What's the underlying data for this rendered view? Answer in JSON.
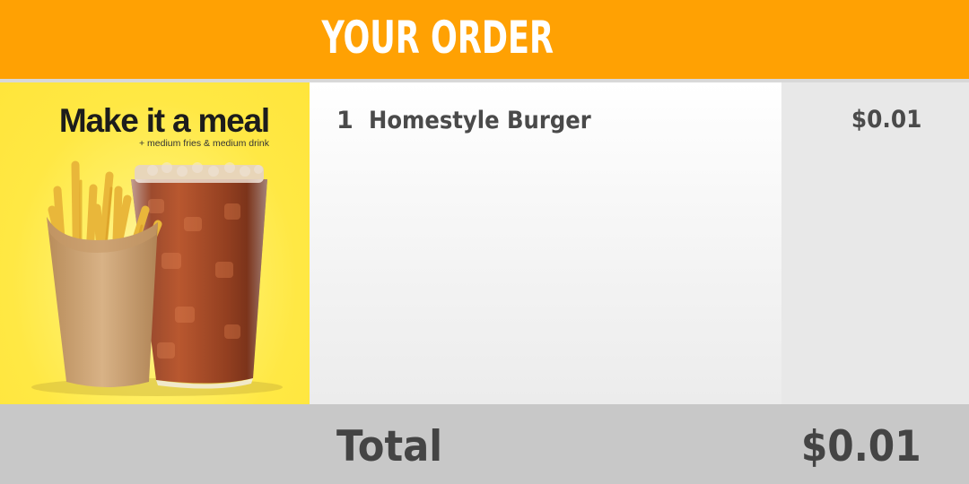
{
  "header": {
    "title": "YOUR ORDER",
    "background_color": "#ffa103"
  },
  "promo": {
    "title": "Make it a meal",
    "subtitle": "+ medium fries & medium drink",
    "background_color": "#ffe53b",
    "images": [
      "fries-icon",
      "soda-cup-icon"
    ]
  },
  "order": {
    "items": [
      {
        "quantity": "1",
        "name": "Homestyle Burger",
        "price": "$0.01"
      }
    ]
  },
  "total": {
    "label": "Total",
    "value": "$0.01"
  }
}
